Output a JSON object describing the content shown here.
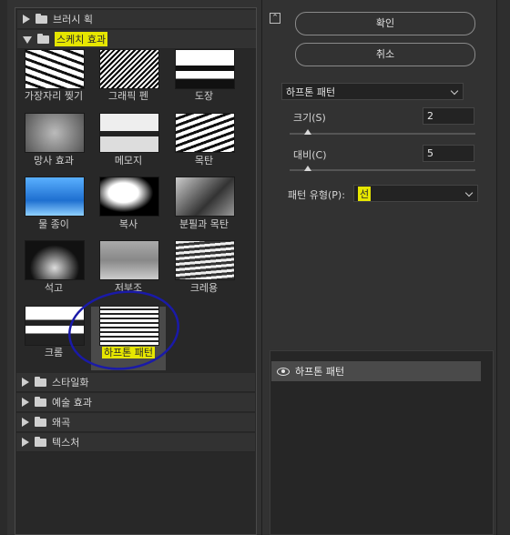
{
  "categories": {
    "brush": "브러시 획",
    "sketch": "스케치 효과",
    "stylize": "스타일화",
    "artistic": "예술 효과",
    "distort": "왜곡",
    "texture": "텍스처"
  },
  "filters": [
    {
      "label": "가장자리 찢기",
      "icon": "torn-edges"
    },
    {
      "label": "그래픽 펜",
      "icon": "graphic-pen"
    },
    {
      "label": "도장",
      "icon": "stamp"
    },
    {
      "label": "망사 효과",
      "icon": "reticulation"
    },
    {
      "label": "메모지",
      "icon": "note-paper"
    },
    {
      "label": "목탄",
      "icon": "charcoal"
    },
    {
      "label": "물 종이",
      "icon": "water-paper"
    },
    {
      "label": "복사",
      "icon": "photocopy"
    },
    {
      "label": "분필과 목탄",
      "icon": "chalk-charcoal"
    },
    {
      "label": "석고",
      "icon": "plaster"
    },
    {
      "label": "저부조",
      "icon": "bas-relief"
    },
    {
      "label": "크레용",
      "icon": "conte-crayon"
    },
    {
      "label": "크롬",
      "icon": "chrome"
    },
    {
      "label": "하프톤 패턴",
      "icon": "halftone-pattern"
    }
  ],
  "buttons": {
    "ok": "확인",
    "cancel": "취소"
  },
  "filter_select": "하프톤 패턴",
  "params": {
    "size_label": "크기(S)",
    "size_value": "2",
    "size_level": 0.1,
    "contrast_label": "대비(C)",
    "contrast_value": "5",
    "contrast_level": 0.1,
    "pattern_label": "패턴 유형(P):",
    "pattern_value": "선"
  },
  "layer": {
    "name": "하프톤 패턴"
  },
  "colors": {
    "highlight": "#e6e600",
    "annotation": "#1a1aa8",
    "selected": "#4a4a4a"
  }
}
